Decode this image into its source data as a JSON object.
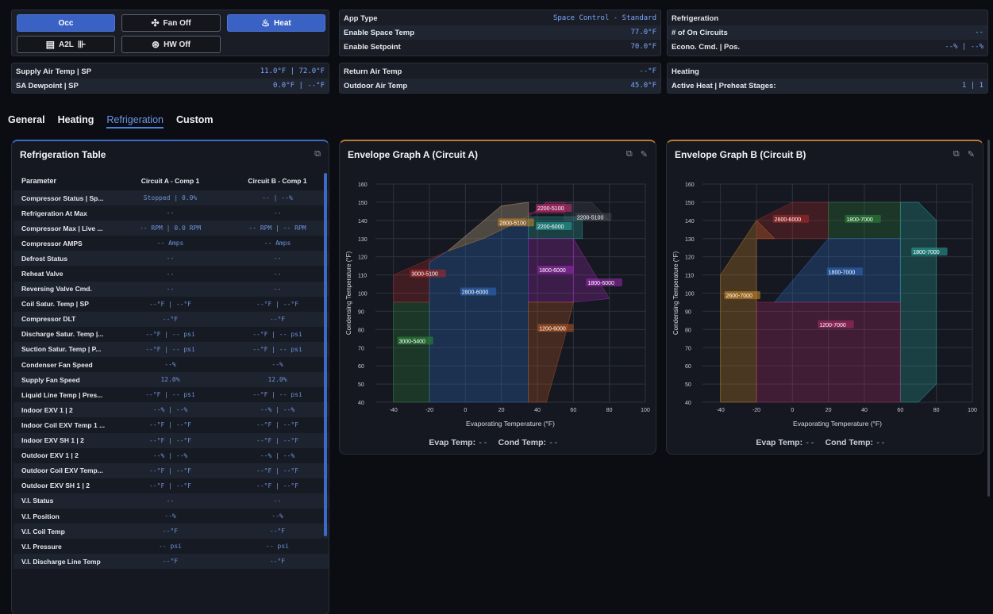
{
  "controls": {
    "occ_label": "Occ",
    "fan_label": "Fan Off",
    "heat_label": "Heat",
    "a2l_label": "A2L",
    "hw_label": "HW Off"
  },
  "panel_app": {
    "rows": [
      {
        "label": "App Type",
        "value": "Space Control - Standard"
      },
      {
        "label": "Enable Space Temp",
        "value": "77.0°F"
      },
      {
        "label": "Enable Setpoint",
        "value": "70.0°F"
      }
    ]
  },
  "panel_refrig": {
    "rows": [
      {
        "label": "Refrigeration",
        "value": ""
      },
      {
        "label": "# of On Circuits",
        "value": "--"
      },
      {
        "label": "Econo. Cmd. | Pos.",
        "value": "--% | --%"
      }
    ]
  },
  "panel_supply": {
    "rows": [
      {
        "label": "Supply Air Temp | SP",
        "value": "11.0°F | 72.0°F"
      },
      {
        "label": "SA Dewpoint | SP",
        "value": "0.0°F | --°F"
      }
    ]
  },
  "panel_return": {
    "rows": [
      {
        "label": "Return Air Temp",
        "value": "--°F"
      },
      {
        "label": "Outdoor Air Temp",
        "value": "45.0°F"
      }
    ]
  },
  "panel_heating": {
    "rows": [
      {
        "label": "Heating",
        "value": ""
      },
      {
        "label": "Active Heat | Preheat Stages:",
        "value": "1 | 1"
      }
    ]
  },
  "tabs": [
    "General",
    "Heating",
    "Refrigeration",
    "Custom"
  ],
  "active_tab": "Refrigeration",
  "table": {
    "title": "Refrigeration Table",
    "headers": [
      "Parameter",
      "Circuit A - Comp 1",
      "Circuit B - Comp 1"
    ],
    "rows": [
      [
        "Compressor Status | Sp...",
        "Stopped | 0.0%",
        "-- | --%"
      ],
      [
        "Refrigeration At Max",
        "--",
        "--"
      ],
      [
        "Compressor Max | Live ...",
        "-- RPM | 0.0 RPM",
        "-- RPM | -- RPM"
      ],
      [
        "Compressor AMPS",
        "-- Amps",
        "-- Amps"
      ],
      [
        "Defrost Status",
        "--",
        "--"
      ],
      [
        "Reheat Valve",
        "--",
        "--"
      ],
      [
        "Reversing Valve Cmd.",
        "--",
        "--"
      ],
      [
        "Coil Satur. Temp | SP",
        "--°F | --°F",
        "--°F | --°F"
      ],
      [
        "Compressor DLT",
        "--°F",
        "--°F"
      ],
      [
        "Discharge Satur. Temp |...",
        "--°F | -- psi",
        "--°F | -- psi"
      ],
      [
        "Suction Satur. Temp | P...",
        "--°F | -- psi",
        "--°F | -- psi"
      ],
      [
        "Condenser Fan Speed",
        "--%",
        "--%"
      ],
      [
        "Supply Fan Speed",
        "12.0%",
        "12.0%"
      ],
      [
        "Liquid Line Temp | Pres...",
        "--°F | -- psi",
        "--°F | -- psi"
      ],
      [
        "Indoor EXV 1 | 2",
        "--% | --%",
        "--% | --%"
      ],
      [
        "Indoor Coil EXV Temp 1 ...",
        "--°F | --°F",
        "--°F | --°F"
      ],
      [
        "Indoor EXV SH 1 | 2",
        "--°F | --°F",
        "--°F | --°F"
      ],
      [
        "Outdoor EXV 1 | 2",
        "--% | --%",
        "--% | --%"
      ],
      [
        "Outdoor Coil EXV Temp...",
        "--°F | --°F",
        "--°F | --°F"
      ],
      [
        "Outdoor EXV SH 1 | 2",
        "--°F | --°F",
        "--°F | --°F"
      ],
      [
        "V.I. Status",
        "--",
        "--"
      ],
      [
        "V.I. Position",
        "--%",
        "--%"
      ],
      [
        "V.I. Coil Temp",
        "--°F",
        "--°F"
      ],
      [
        "V.I. Pressure",
        "-- psi",
        "-- psi"
      ],
      [
        "V.I. Discharge Line Temp",
        "--°F",
        "--°F"
      ]
    ]
  },
  "graph_a": {
    "title": "Envelope Graph A (Circuit A)",
    "evap_label": "Evap Temp:",
    "evap_value": "--",
    "cond_label": "Cond Temp:",
    "cond_value": "--"
  },
  "graph_b": {
    "title": "Envelope Graph B (Circuit B)",
    "evap_label": "Evap Temp:",
    "evap_value": "--",
    "cond_label": "Cond Temp:",
    "cond_value": "--"
  },
  "chart_data": [
    {
      "type": "area",
      "xlabel": "Evaporating Temperature (°F)",
      "ylabel": "Condensing Temperature (°F)",
      "xlim": [
        -50,
        100
      ],
      "ylim": [
        40,
        160
      ],
      "xticks": [
        -40,
        -20,
        0,
        20,
        40,
        60,
        80,
        100
      ],
      "yticks": [
        40,
        50,
        60,
        70,
        80,
        90,
        100,
        110,
        120,
        130,
        140,
        150,
        160
      ],
      "grid": true,
      "regions": [
        {
          "name": "3000-5400",
          "color": "#2e8a3a",
          "points": [
            [
              -40,
              40
            ],
            [
              -20,
              40
            ],
            [
              -20,
              95
            ],
            [
              -40,
              95
            ]
          ],
          "label_at": [
            -37,
            73
          ]
        },
        {
          "name": "3000-5100",
          "color": "#b02a2a",
          "points": [
            [
              -40,
              95
            ],
            [
              -20,
              95
            ],
            [
              -20,
              117
            ],
            [
              -10,
              123
            ],
            [
              -40,
              110
            ]
          ],
          "label_at": [
            -30,
            110
          ]
        },
        {
          "name": "2800-6000",
          "color": "#2f6ec9",
          "points": [
            [
              -20,
              40
            ],
            [
              35,
              40
            ],
            [
              35,
              150
            ],
            [
              20,
              148
            ],
            [
              -10,
              123
            ],
            [
              -20,
              117
            ]
          ],
          "label_at": [
            -2,
            100
          ]
        },
        {
          "name": "2800-5100",
          "color": "#d08a25",
          "points": [
            [
              -10,
              123
            ],
            [
              20,
              148
            ],
            [
              35,
              150
            ],
            [
              35,
              142
            ],
            [
              10,
              130
            ]
          ],
          "label_at": [
            19,
            138
          ]
        },
        {
          "name": "2200-5100",
          "color": "#d0307a",
          "points": [
            [
              35,
              142
            ],
            [
              45,
              150
            ],
            [
              55,
              150
            ],
            [
              55,
              144
            ],
            [
              35,
              144
            ]
          ],
          "label_at": [
            40,
            146
          ]
        },
        {
          "name": "2200-5100 ",
          "color": "#4a4d55",
          "points": [
            [
              55,
              140
            ],
            [
              55,
              150
            ],
            [
              70,
              150
            ],
            [
              80,
              140
            ]
          ],
          "label_at": [
            62,
            141
          ]
        },
        {
          "name": "2200-6000",
          "color": "#2aa8a0",
          "points": [
            [
              35,
              130
            ],
            [
              35,
              142
            ],
            [
              65,
              142
            ],
            [
              65,
              130
            ]
          ],
          "label_at": [
            40,
            136
          ]
        },
        {
          "name": "1800-6000",
          "color": "#a02ab8",
          "points": [
            [
              35,
              95
            ],
            [
              35,
              130
            ],
            [
              60,
              130
            ],
            [
              60,
              95
            ]
          ],
          "label_at": [
            41,
            112
          ]
        },
        {
          "name": "1800-6000 ",
          "color": "#a02ab8",
          "points": [
            [
              60,
              95
            ],
            [
              60,
              130
            ],
            [
              80,
              97
            ]
          ],
          "label_at": [
            68,
            105
          ]
        },
        {
          "name": "1200-6000",
          "color": "#c05a22",
          "points": [
            [
              35,
              40
            ],
            [
              35,
              95
            ],
            [
              60,
              95
            ],
            [
              55,
              75
            ],
            [
              45,
              40
            ]
          ],
          "label_at": [
            41,
            80
          ]
        }
      ]
    },
    {
      "type": "area",
      "xlabel": "Evaporating Temperature (°F)",
      "ylabel": "Condensing Temperature (°F)",
      "xlim": [
        -50,
        100
      ],
      "ylim": [
        40,
        160
      ],
      "xticks": [
        -40,
        -20,
        0,
        20,
        40,
        60,
        80,
        100
      ],
      "yticks": [
        40,
        50,
        60,
        70,
        80,
        90,
        100,
        110,
        120,
        130,
        140,
        150,
        160
      ],
      "grid": true,
      "regions": [
        {
          "name": "2600-7000",
          "color": "#d08a25",
          "points": [
            [
              -40,
              40
            ],
            [
              -20,
              40
            ],
            [
              -20,
              130
            ],
            [
              -10,
              130
            ],
            [
              -20,
              140
            ],
            [
              -40,
              110
            ]
          ],
          "label_at": [
            -37,
            98
          ]
        },
        {
          "name": "2600-6000",
          "color": "#b02a2a",
          "points": [
            [
              -20,
              130
            ],
            [
              -20,
              140
            ],
            [
              0,
              150
            ],
            [
              20,
              150
            ],
            [
              20,
              130
            ]
          ],
          "label_at": [
            -10,
            140
          ]
        },
        {
          "name": "1800-7000",
          "color": "#2e8a3a",
          "points": [
            [
              20,
              130
            ],
            [
              20,
              150
            ],
            [
              60,
              150
            ],
            [
              60,
              130
            ]
          ],
          "label_at": [
            30,
            140
          ]
        },
        {
          "name": "1800-7000 ",
          "color": "#2f6ec9",
          "points": [
            [
              -10,
              95
            ],
            [
              20,
              130
            ],
            [
              60,
              130
            ],
            [
              60,
              95
            ]
          ],
          "label_at": [
            20,
            111
          ]
        },
        {
          "name": "1800-7000  ",
          "color": "#2aa8a0",
          "points": [
            [
              60,
              40
            ],
            [
              60,
              150
            ],
            [
              70,
              150
            ],
            [
              80,
              140
            ],
            [
              80,
              50
            ],
            [
              70,
              40
            ]
          ],
          "label_at": [
            67,
            122
          ]
        },
        {
          "name": "1200-7000",
          "color": "#b02a6a",
          "points": [
            [
              -20,
              40
            ],
            [
              60,
              40
            ],
            [
              60,
              95
            ],
            [
              -20,
              95
            ]
          ],
          "label_at": [
            15,
            82
          ]
        }
      ]
    }
  ]
}
